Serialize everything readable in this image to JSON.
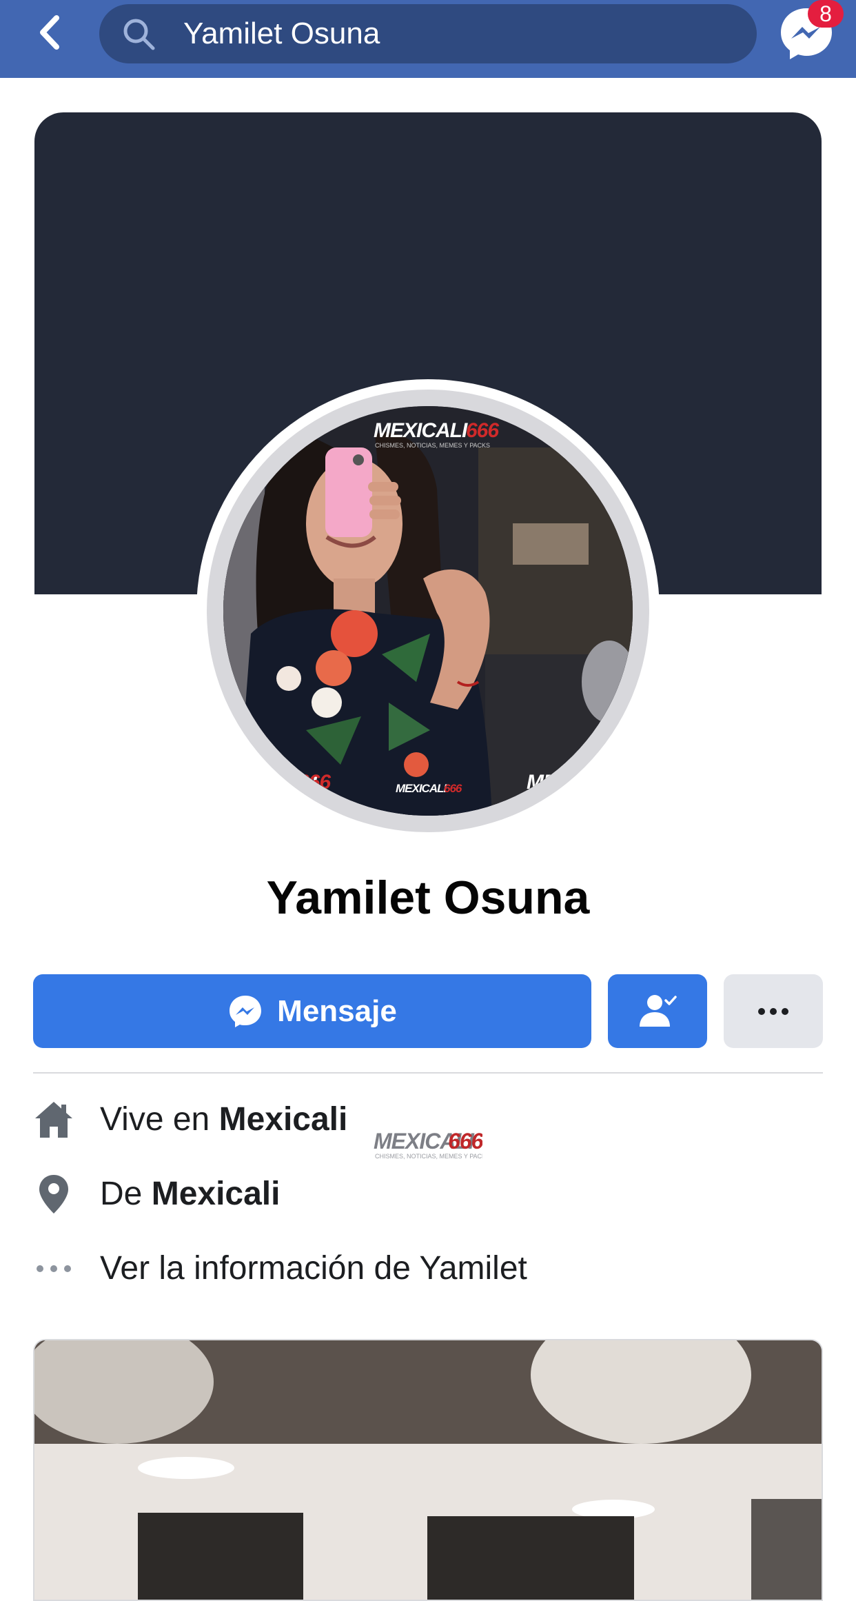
{
  "header": {
    "search_value": "Yamilet Osuna",
    "notification_count": "8",
    "colors": {
      "bar": "#4267b2",
      "search_bg": "#2f4a80",
      "badge": "#e41e3f"
    }
  },
  "profile": {
    "name": "Yamilet Osuna",
    "watermark": {
      "brand": "MEXICALI",
      "number": "666",
      "tagline": "CHISMES, NOTICIAS, MEMES Y PACKS"
    }
  },
  "actions": {
    "message_label": "Mensaje",
    "colors": {
      "primary": "#3578e5",
      "secondary": "#e4e6eb"
    }
  },
  "info": {
    "lives_prefix": "Vive en",
    "lives_city": "Mexicali",
    "from_prefix": "De",
    "from_city": "Mexicali",
    "see_info": "Ver la información de Yamilet"
  },
  "icons": {
    "back": "chevron-left-icon",
    "search": "search-icon",
    "messenger": "messenger-icon",
    "friends": "friend-check-icon",
    "more": "more-dots-icon",
    "home": "home-icon",
    "location": "location-pin-icon",
    "ellipsis": "ellipsis-icon"
  }
}
